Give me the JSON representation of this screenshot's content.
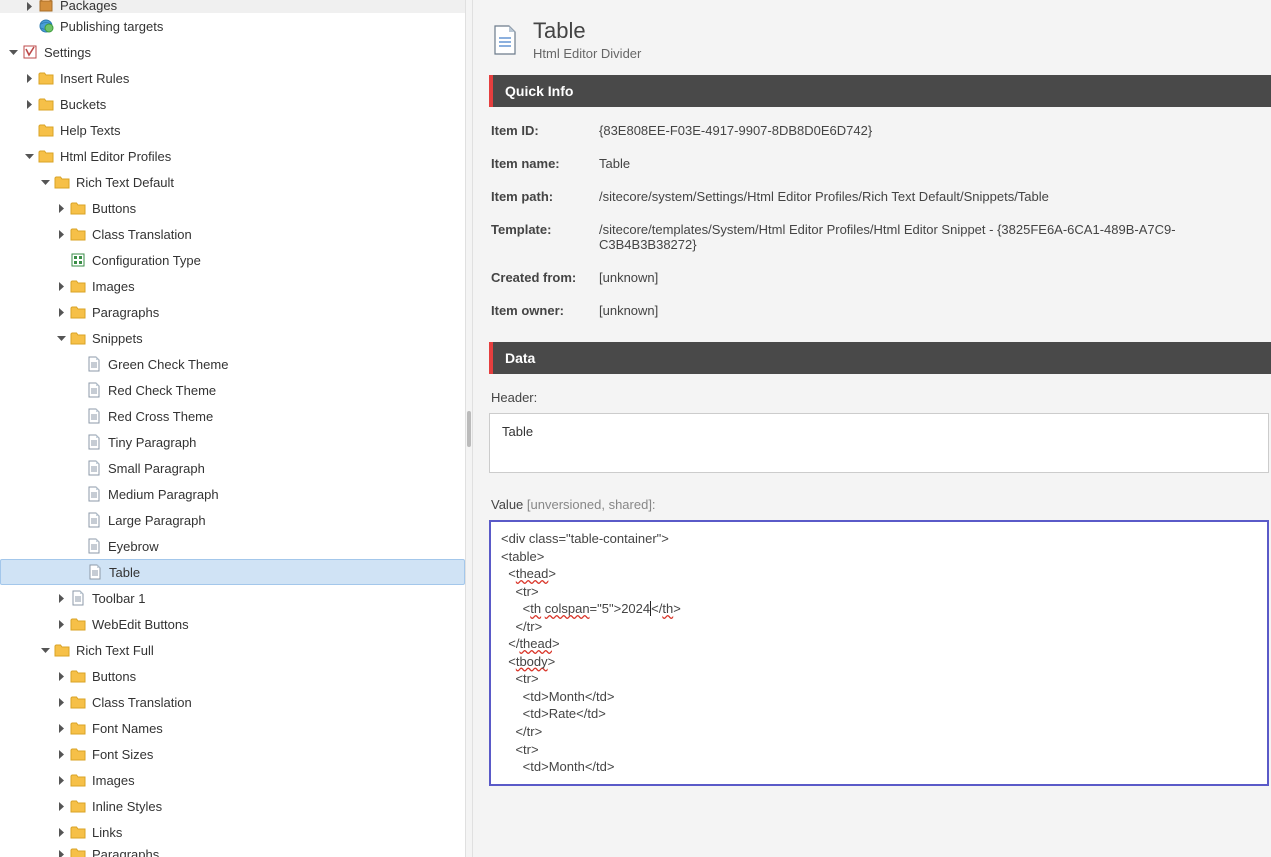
{
  "tree": {
    "packages": "Packages",
    "publishing": "Publishing targets",
    "settings": "Settings",
    "insert_rules": "Insert Rules",
    "buckets": "Buckets",
    "help_texts": "Help Texts",
    "html_editor_profiles": "Html Editor Profiles",
    "rich_text_default": "Rich Text Default",
    "buttons": "Buttons",
    "class_translation": "Class Translation",
    "configuration_type": "Configuration Type",
    "images": "Images",
    "paragraphs": "Paragraphs",
    "snippets": "Snippets",
    "green_check": "Green Check Theme",
    "red_check": "Red Check Theme",
    "red_cross": "Red Cross Theme",
    "tiny_para": "Tiny Paragraph",
    "small_para": "Small Paragraph",
    "medium_para": "Medium Paragraph",
    "large_para": "Large Paragraph",
    "eyebrow": "Eyebrow",
    "table": "Table",
    "toolbar1": "Toolbar 1",
    "webedit_buttons": "WebEdit Buttons",
    "rich_text_full": "Rich Text Full",
    "font_names": "Font Names",
    "font_sizes": "Font Sizes",
    "inline_styles": "Inline Styles",
    "links": "Links",
    "paragraphs2": "Paragraphs"
  },
  "header": {
    "title": "Table",
    "subtitle": "Html Editor Divider"
  },
  "sections": {
    "quick_info": "Quick Info",
    "data": "Data"
  },
  "quickinfo": {
    "item_id_label": "Item ID:",
    "item_id": "{83E808EE-F03E-4917-9907-8DB8D0E6D742}",
    "item_name_label": "Item name:",
    "item_name": "Table",
    "item_path_label": "Item path:",
    "item_path": "/sitecore/system/Settings/Html Editor Profiles/Rich Text Default/Snippets/Table",
    "template_label": "Template:",
    "template": "/sitecore/templates/System/Html Editor Profiles/Html Editor Snippet - {3825FE6A-6CA1-489B-A7C9-C3B4B3B38272}",
    "created_from_label": "Created from:",
    "created_from": "[unknown]",
    "item_owner_label": "Item owner:",
    "item_owner": "[unknown]"
  },
  "data": {
    "header_label": "Header:",
    "header_value": "Table",
    "value_label": "Value",
    "value_suffix": " [unversioned, shared]:",
    "code": {
      "l1": "<div class=\"table-container\">",
      "l2": "<table>",
      "l3_a": "  <",
      "l3_b": "thead",
      "l3_c": ">",
      "l4": "    <tr>",
      "l5_a": "      <",
      "l5_b": "th",
      "l5_c": " ",
      "l5_d": "colspan",
      "l5_e": "=\"5\">2024",
      "l5_f": "</",
      "l5_g": "th",
      "l5_h": ">",
      "l6": "    </tr>",
      "l7_a": "  </",
      "l7_b": "thead",
      "l7_c": ">",
      "l8_a": "  <",
      "l8_b": "tbody",
      "l8_c": ">",
      "l9": "    <tr>",
      "l10": "      <td>Month</td>",
      "l11": "      <td>Rate</td>",
      "l12": "    </tr>",
      "l13": "    <tr>",
      "l14": "      <td>Month</td>"
    }
  }
}
